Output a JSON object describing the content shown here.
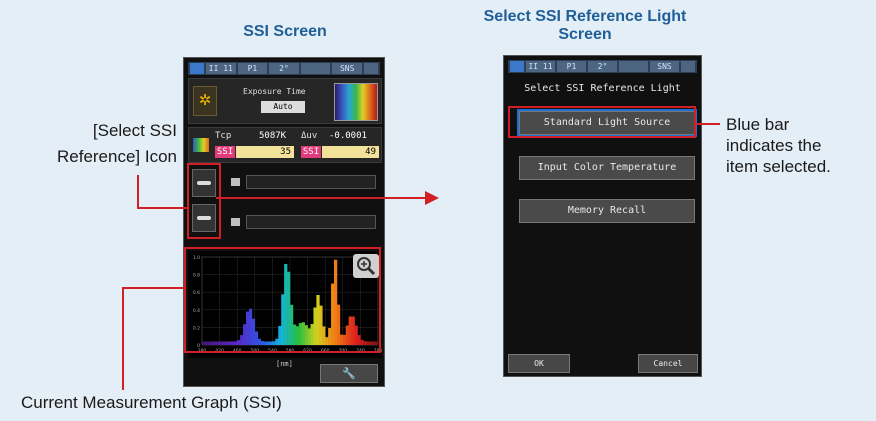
{
  "titles": {
    "ssi_screen": "SSI Screen",
    "select_line1": "Select SSI Reference Light",
    "select_line2": "Screen"
  },
  "callouts": {
    "ref_icon_1": "[Select SSI",
    "ref_icon_2": "Reference] Icon",
    "graph": "Current Measurement Graph (SSI)",
    "bluebar_1": "Blue bar",
    "bluebar_2": "indicates the",
    "bluebar_3": "item selected."
  },
  "left_device": {
    "status": [
      "II 11",
      "P1",
      "2°",
      "",
      "SNS"
    ],
    "exposure_label": "Exposure Time",
    "exposure_value": "Auto",
    "tcp_label": "Tcp",
    "tcp_value": "5087K",
    "duv_label": "Δuv",
    "duv_value": "-0.0001",
    "ssi1_label": "SSI",
    "ssi1_value": "35",
    "ssi2_label": "SSI",
    "ssi2_value": "49",
    "graph_unit": "[nm]",
    "graph_yticks": [
      "1.0",
      "0.8",
      "0.6",
      "0.4",
      "0.2",
      "0"
    ],
    "graph_xticks": [
      "380",
      "420",
      "460",
      "500",
      "540",
      "580",
      "620",
      "660",
      "700",
      "740",
      "780"
    ]
  },
  "right_device": {
    "status": [
      "II 11",
      "P1",
      "2°",
      "",
      "SNS"
    ],
    "header": "Select SSI Reference Light",
    "options": [
      "Standard Light Source",
      "Input Color Temperature",
      "Memory Recall"
    ],
    "ok_label": "OK",
    "cancel_label": "Cancel"
  },
  "colors": {
    "accent_title": "#1f5f98",
    "annotation_red": "#d21f26",
    "selection_blue": "#1e6ed8",
    "ssi_badge": "#e23a7a",
    "ssi_value_bg": "#f3e39a"
  }
}
